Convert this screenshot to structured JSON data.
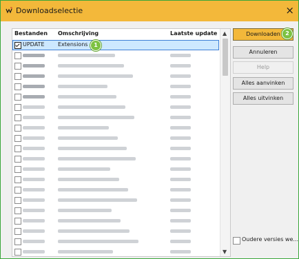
{
  "window": {
    "title": "Downloadselectie",
    "close_glyph": "×",
    "icon": "download-app-icon"
  },
  "columns": [
    "Bestanden",
    "Omschrijving",
    "Laatste update"
  ],
  "rows": [
    {
      "checked": true,
      "name": "UPDATE",
      "description": "Extensions",
      "selected": true
    },
    {
      "checked": false,
      "blurred": true,
      "dark_icon": true
    },
    {
      "checked": false,
      "blurred": true,
      "dark_icon": true
    },
    {
      "checked": false,
      "blurred": true,
      "dark_icon": true
    },
    {
      "checked": false,
      "blurred": true,
      "dark_icon": true
    },
    {
      "checked": false,
      "blurred": true,
      "dark_icon": true
    },
    {
      "checked": false,
      "blurred": true
    },
    {
      "checked": false,
      "blurred": true
    },
    {
      "checked": false,
      "blurred": true
    },
    {
      "checked": false,
      "blurred": true
    },
    {
      "checked": false,
      "blurred": true
    },
    {
      "checked": false,
      "blurred": true
    },
    {
      "checked": false,
      "blurred": true
    },
    {
      "checked": false,
      "blurred": true
    },
    {
      "checked": false,
      "blurred": true
    },
    {
      "checked": false,
      "blurred": true
    },
    {
      "checked": false,
      "blurred": true
    },
    {
      "checked": false,
      "blurred": true
    },
    {
      "checked": false,
      "blurred": true
    },
    {
      "checked": false,
      "blurred": true
    },
    {
      "checked": false,
      "blurred": true
    },
    {
      "checked": false,
      "blurred": true
    }
  ],
  "buttons": {
    "download": "Downloaden",
    "cancel": "Annuleren",
    "help": "Help",
    "check_all": "Alles aanvinken",
    "uncheck_all": "Alles uitvinken"
  },
  "badges": {
    "one": "1",
    "two": "2"
  },
  "older_versions": {
    "label": "Oudere versies we...",
    "checked": false
  },
  "colors": {
    "accent": "#f3b83a",
    "frame": "#3aa63a",
    "badge": "#7dc242",
    "selection": "#cde8ff"
  }
}
